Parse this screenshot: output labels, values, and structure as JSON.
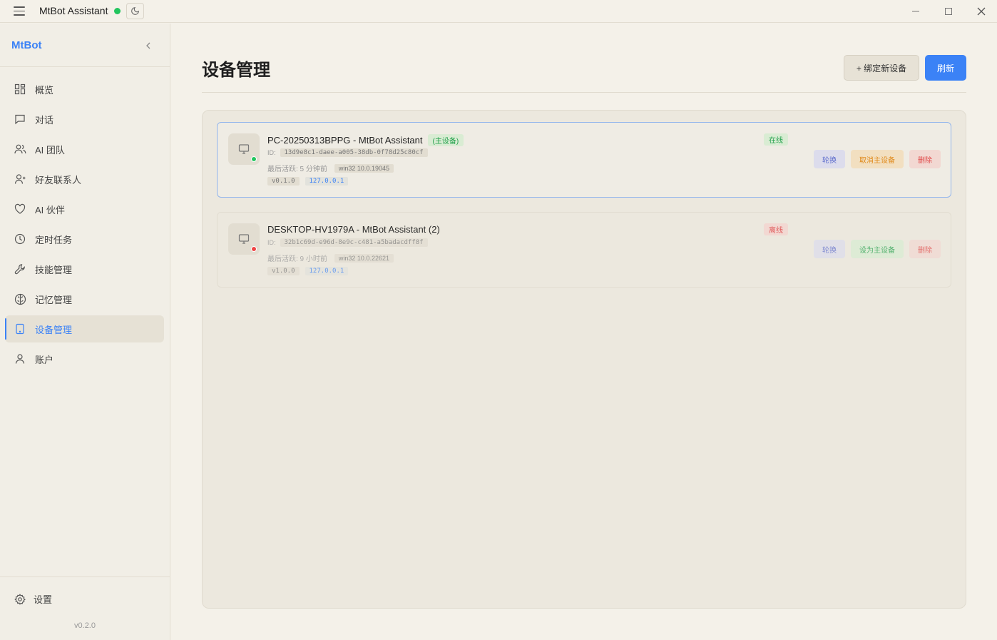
{
  "titlebar": {
    "app_title": "MtBot Assistant",
    "status_color": "#22c55e"
  },
  "sidebar": {
    "brand": "MtBot",
    "items": [
      {
        "label": "概览",
        "icon": "grid-icon"
      },
      {
        "label": "对话",
        "icon": "chat-icon"
      },
      {
        "label": "AI 团队",
        "icon": "team-icon"
      },
      {
        "label": "好友联系人",
        "icon": "contact-icon"
      },
      {
        "label": "AI 伙伴",
        "icon": "heart-icon"
      },
      {
        "label": "定时任务",
        "icon": "clock-icon"
      },
      {
        "label": "技能管理",
        "icon": "wrench-icon"
      },
      {
        "label": "记忆管理",
        "icon": "brain-icon"
      },
      {
        "label": "设备管理",
        "icon": "tablet-icon",
        "active": true
      },
      {
        "label": "账户",
        "icon": "user-icon"
      }
    ],
    "settings_label": "设置",
    "version": "v0.2.0"
  },
  "main": {
    "title": "设备管理",
    "bind_button": "+ 绑定新设备",
    "refresh_button": "刷新"
  },
  "devices": [
    {
      "name": "PC-20250313BPPG - MtBot Assistant",
      "primary_tag": "(主设备)",
      "id_label": "ID:",
      "id": "13d9e8c1-daee-a005-38db-0f78d25c80cf",
      "last_active": "最后活跃: 5 分钟前",
      "platform": "win32 10.0.19045",
      "version": "v0.1.0",
      "ip": "127.0.0.1",
      "status": "在线",
      "status_color": "#22c55e",
      "actions": {
        "switch": "轮换",
        "primary": "取消主设备",
        "delete": "删除"
      }
    },
    {
      "name": "DESKTOP-HV1979A - MtBot Assistant (2)",
      "id_label": "ID:",
      "id": "32b1c69d-e96d-8e9c-c481-a5badacdff8f",
      "last_active": "最后活跃: 9 小时前",
      "platform": "win32 10.0.22621",
      "version": "v1.0.0",
      "ip": "127.0.0.1",
      "status": "离线",
      "status_color": "#ef4444",
      "actions": {
        "switch": "轮换",
        "primary": "设为主设备",
        "delete": "删除"
      }
    }
  ]
}
